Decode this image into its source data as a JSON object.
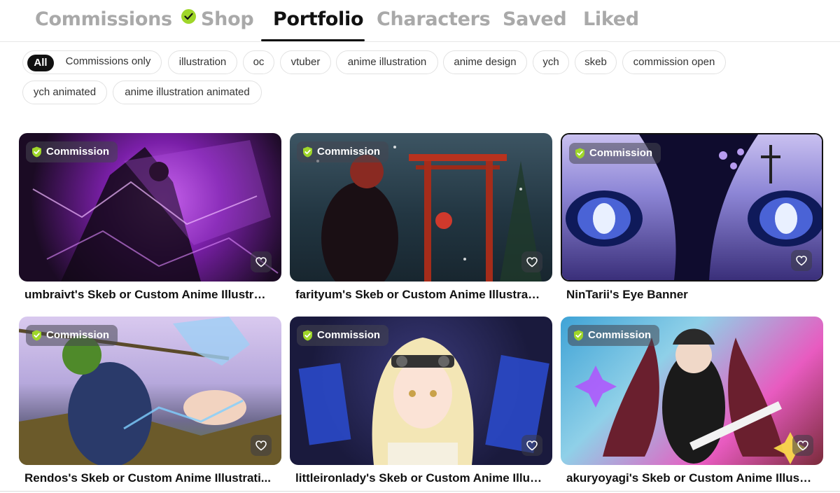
{
  "tabs": [
    {
      "label": "Commissions",
      "verified": true
    },
    {
      "label": "Shop"
    },
    {
      "label": "Portfolio",
      "active": true
    },
    {
      "label": "Characters"
    },
    {
      "label": "Saved"
    },
    {
      "label": "Liked"
    }
  ],
  "filters": {
    "all_label": "All",
    "commissions_only_label": "Commissions only",
    "tags": [
      "illustration",
      "oc",
      "vtuber",
      "anime illustration",
      "anime design",
      "ych",
      "skeb",
      "commission open",
      "ych animated",
      "anime illustration animated"
    ]
  },
  "badge_label": "Commission",
  "cards": [
    {
      "title": "umbraivt's Skeb or Custom Anime Illustrat...",
      "palette": [
        "#1b0b24",
        "#7a1fa8",
        "#d26cf2"
      ]
    },
    {
      "title": "farityum's Skeb or Custom Anime Illustrati...",
      "palette": [
        "#18262f",
        "#3d5563",
        "#b8321e"
      ]
    },
    {
      "title": "NinTarii's Eye Banner",
      "palette": [
        "#0f0c2e",
        "#4a63d6",
        "#e9d8ff"
      ]
    },
    {
      "title": "Rendos's Skeb or Custom Anime Illustrati...",
      "palette": [
        "#c6b3e6",
        "#6f6b8f",
        "#5f7a2f"
      ]
    },
    {
      "title": "littleironlady's Skeb or Custom Anime Illus...",
      "palette": [
        "#1a1a3d",
        "#2a49c9",
        "#f3e6b5"
      ]
    },
    {
      "title": "akuryoyagi's Skeb or Custom Anime Illustr...",
      "palette": [
        "#3fa3d6",
        "#7a2b3a",
        "#e85bc0"
      ]
    }
  ],
  "colors": {
    "accent": "#9fd62a",
    "text": "#111111",
    "muted": "#a9a9a9"
  },
  "icons": [
    "verified-check-icon",
    "shield-check-icon",
    "heart-icon"
  ]
}
